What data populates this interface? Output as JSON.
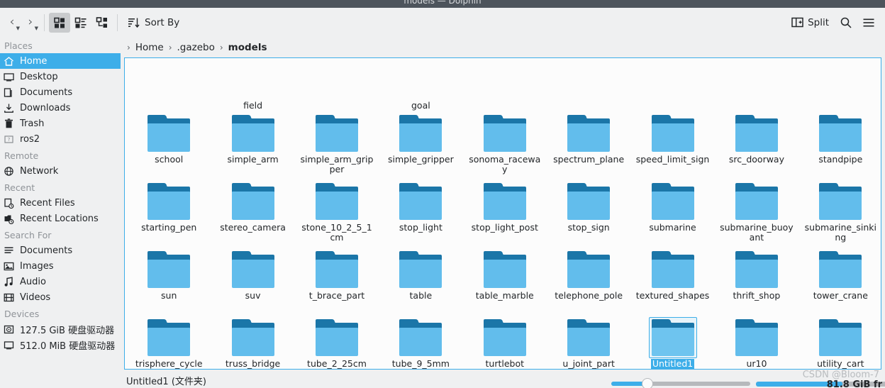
{
  "window": {
    "title": "models — Dolphin",
    "titlebar_color": "#4d545c"
  },
  "colors": {
    "accent": "#3daee9",
    "folder_front": "#62bdec",
    "folder_back": "#1b76a8",
    "background": "#eff0f1",
    "view_background": "#fcfcfc"
  },
  "toolbar": {
    "back_icon": "chevron-left-icon",
    "forward_icon": "chevron-right-icon",
    "view_icons_label": "icons-view",
    "view_details_label": "details-view",
    "view_tree_label": "tree-view",
    "sort_by_label": "Sort By",
    "sort_icon": "sort-icon",
    "split_label": "Split",
    "split_icon": "split-icon",
    "search_icon": "search-icon",
    "menu_icon": "hamburger-menu-icon"
  },
  "breadcrumb": {
    "items": [
      {
        "label": "Home",
        "current": false
      },
      {
        "label": ".gazebo",
        "current": false
      },
      {
        "label": "models",
        "current": true
      }
    ],
    "separator": "›"
  },
  "sidebar": {
    "groups": [
      {
        "title": "Places",
        "items": [
          {
            "label": "Home",
            "icon": "home-icon",
            "selected": true
          },
          {
            "label": "Desktop",
            "icon": "desktop-icon",
            "selected": false
          },
          {
            "label": "Documents",
            "icon": "documents-icon",
            "selected": false
          },
          {
            "label": "Downloads",
            "icon": "downloads-icon",
            "selected": false
          },
          {
            "label": "Trash",
            "icon": "trash-icon",
            "selected": false
          },
          {
            "label": "ros2",
            "icon": "folder-unknown-icon",
            "selected": false
          }
        ]
      },
      {
        "title": "Remote",
        "items": [
          {
            "label": "Network",
            "icon": "network-icon",
            "selected": false
          }
        ]
      },
      {
        "title": "Recent",
        "items": [
          {
            "label": "Recent Files",
            "icon": "recent-files-icon",
            "selected": false
          },
          {
            "label": "Recent Locations",
            "icon": "recent-locations-icon",
            "selected": false
          }
        ]
      },
      {
        "title": "Search For",
        "items": [
          {
            "label": "Documents",
            "icon": "search-documents-icon",
            "selected": false
          },
          {
            "label": "Images",
            "icon": "search-images-icon",
            "selected": false
          },
          {
            "label": "Audio",
            "icon": "search-audio-icon",
            "selected": false
          },
          {
            "label": "Videos",
            "icon": "search-videos-icon",
            "selected": false
          }
        ]
      },
      {
        "title": "Devices",
        "items": [
          {
            "label": "127.5 GiB 硬盘驱动器",
            "icon": "harddisk-icon",
            "selected": false
          },
          {
            "label": "512.0 MiB 硬盘驱动器",
            "icon": "harddisk-icon",
            "selected": false
          }
        ]
      }
    ]
  },
  "files": {
    "columns": 9,
    "clipped_top_row": [
      {
        "name": "",
        "clipped": true
      },
      {
        "name": "field",
        "clipped": true
      },
      {
        "name": "",
        "clipped": true
      },
      {
        "name": "goal",
        "clipped": true
      },
      {
        "name": "",
        "clipped": true
      },
      {
        "name": "",
        "clipped": true
      },
      {
        "name": "",
        "clipped": true
      },
      {
        "name": "",
        "clipped": true
      },
      {
        "name": "",
        "clipped": true
      }
    ],
    "items": [
      {
        "name": "school",
        "selected": false
      },
      {
        "name": "simple_arm",
        "selected": false
      },
      {
        "name": "simple_arm_gripper",
        "selected": false
      },
      {
        "name": "simple_gripper",
        "selected": false
      },
      {
        "name": "sonoma_raceway",
        "selected": false
      },
      {
        "name": "spectrum_plane",
        "selected": false
      },
      {
        "name": "speed_limit_sign",
        "selected": false
      },
      {
        "name": "src_doorway",
        "selected": false
      },
      {
        "name": "standpipe",
        "selected": false
      },
      {
        "name": "starting_pen",
        "selected": false
      },
      {
        "name": "stereo_camera",
        "selected": false
      },
      {
        "name": "stone_10_2_5_1cm",
        "selected": false
      },
      {
        "name": "stop_light",
        "selected": false
      },
      {
        "name": "stop_light_post",
        "selected": false
      },
      {
        "name": "stop_sign",
        "selected": false
      },
      {
        "name": "submarine",
        "selected": false
      },
      {
        "name": "submarine_buoyant",
        "selected": false
      },
      {
        "name": "submarine_sinking",
        "selected": false
      },
      {
        "name": "sun",
        "selected": false
      },
      {
        "name": "suv",
        "selected": false
      },
      {
        "name": "t_brace_part",
        "selected": false
      },
      {
        "name": "table",
        "selected": false
      },
      {
        "name": "table_marble",
        "selected": false
      },
      {
        "name": "telephone_pole",
        "selected": false
      },
      {
        "name": "textured_shapes",
        "selected": false
      },
      {
        "name": "thrift_shop",
        "selected": false
      },
      {
        "name": "tower_crane",
        "selected": false
      },
      {
        "name": "trisphere_cycle",
        "selected": false
      },
      {
        "name": "truss_bridge",
        "selected": false
      },
      {
        "name": "tube_2_25cm",
        "selected": false
      },
      {
        "name": "tube_9_5mm",
        "selected": false
      },
      {
        "name": "turtlebot",
        "selected": false
      },
      {
        "name": "u_joint_part",
        "selected": false
      },
      {
        "name": "Untitled1",
        "selected": true
      },
      {
        "name": "ur10",
        "selected": false
      },
      {
        "name": "utility_cart",
        "selected": false
      }
    ]
  },
  "statusbar": {
    "selection_text": "Untitled1 (文件夹)",
    "free_space_text": "81.8 GiB fr",
    "zoom_value": 22
  },
  "watermark": {
    "text": "CSDN @Bloom-7"
  }
}
